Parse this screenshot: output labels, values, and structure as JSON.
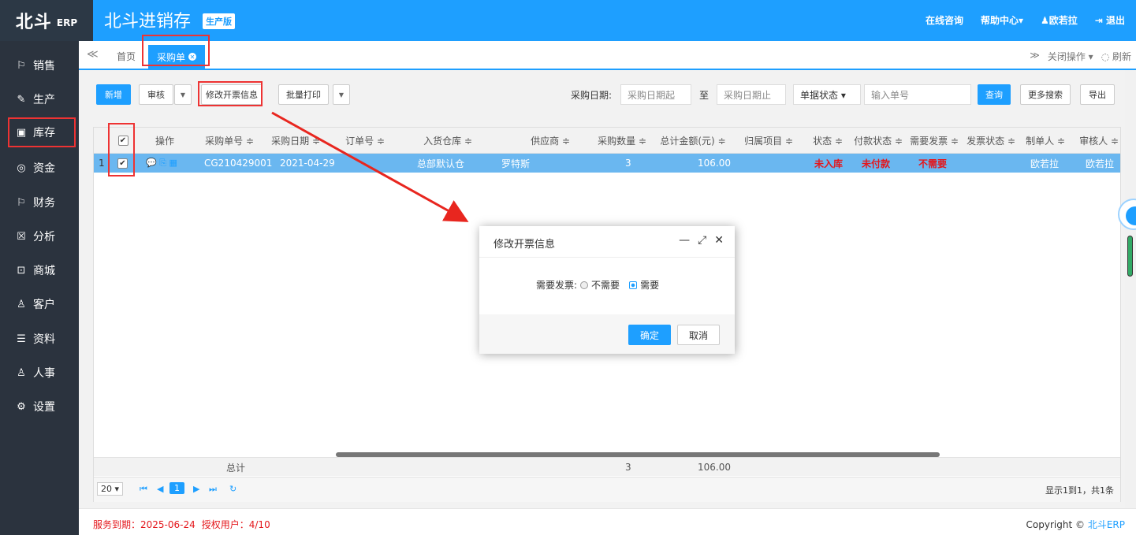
{
  "header": {
    "logo_big": "北斗",
    "logo_small": "ERP",
    "app_title": "北斗进销存",
    "app_badge": "生产版",
    "links": {
      "consult": "在线咨询",
      "help": "帮助中心▾",
      "user": "♟欧若拉",
      "logout": "⇥ 退出"
    }
  },
  "sidebar": {
    "items": [
      {
        "label": "销售",
        "icon": "⚐"
      },
      {
        "label": "生产",
        "icon": "✎"
      },
      {
        "label": "库存",
        "icon": "▣"
      },
      {
        "label": "资金",
        "icon": "◎"
      },
      {
        "label": "财务",
        "icon": "⚐"
      },
      {
        "label": "分析",
        "icon": "☒"
      },
      {
        "label": "商城",
        "icon": "⊡"
      },
      {
        "label": "客户",
        "icon": "♙"
      },
      {
        "label": "资料",
        "icon": "☰"
      },
      {
        "label": "人事",
        "icon": "♙"
      },
      {
        "label": "设置",
        "icon": "⚙"
      }
    ]
  },
  "tabs": {
    "nav_left": "≪",
    "home": "首页",
    "active": "采购单",
    "nav_right": "≫",
    "close_ops": "关闭操作 ▾",
    "refresh": "◌ 刷新"
  },
  "toolbar": {
    "add": "新增",
    "audit": "审核",
    "edit_invoice": "修改开票信息",
    "batch_print": "批量打印",
    "date_label": "采购日期:",
    "date_from": "采购日期起",
    "date_to_label": "至",
    "date_to": "采购日期止",
    "doc_status": "单据状态 ▾",
    "order_no_placeholder": "输入单号",
    "query": "查询",
    "more_search": "更多搜索",
    "export": "导出"
  },
  "grid": {
    "columns": [
      "操作",
      "采购单号 ≑",
      "采购日期 ≑",
      "订单号 ≑",
      "入货仓库 ≑",
      "供应商 ≑",
      "采购数量 ≑",
      "总计金额(元) ≑",
      "归属项目 ≑",
      "状态 ≑",
      "付款状态 ≑",
      "需要发票 ≑",
      "发票状态 ≑",
      "制单人 ≑",
      "审核人 ≑"
    ],
    "rows": [
      {
        "index": "1",
        "ops": "💬 ⎘ ▦",
        "order_no": "CG210429001",
        "date": "2021-04-29",
        "sales_order": "",
        "warehouse": "总部默认仓",
        "supplier": "罗特斯",
        "qty": "3",
        "amount": "106.00",
        "project": "",
        "status": "未入库",
        "pay_status": "未付款",
        "need_invoice": "不需要",
        "invoice_status": "",
        "creator": "欧若拉",
        "auditor": "欧若拉"
      }
    ],
    "footer": {
      "label": "总计",
      "qty": "3",
      "amount": "106.00"
    },
    "pager": {
      "page_size": "20 ▾",
      "first": "⏮",
      "prev": "◀",
      "page": "1",
      "next": "▶",
      "last": "⏭",
      "reload": "↻",
      "summary": "显示1到1，共1条"
    }
  },
  "status": {
    "expiry": "服务到期：2025-06-24",
    "users": "授权用户：4/10",
    "copyright": "Copyright ©",
    "brand": "北斗ERP"
  },
  "dialog": {
    "title": "修改开票信息",
    "minimize": "—",
    "maximize": "⤢",
    "close": "✕",
    "question": "需要发票:",
    "opt_no": "不需要",
    "opt_yes": "需要",
    "selected": "需要",
    "ok": "确定",
    "cancel": "取消"
  },
  "colors": {
    "primary": "#1e9fff",
    "sidebar": "#2b333e",
    "highlight": "#e33",
    "row_selected": "#6ab7f0"
  }
}
